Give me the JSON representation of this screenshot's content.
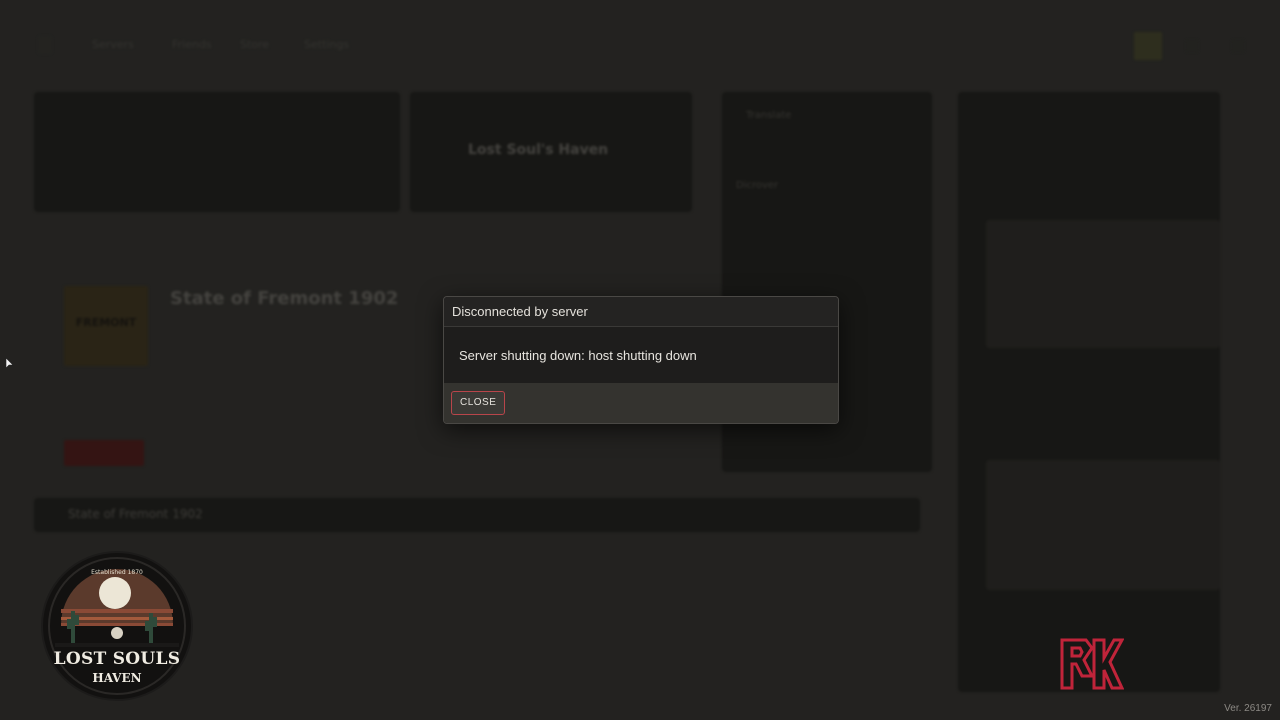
{
  "background": {
    "nav": [
      "Servers",
      "Friends",
      "Store",
      "Settings"
    ],
    "server_header": "Lost Soul's Haven",
    "game_title": "State of Fremont 1902",
    "game_subtitle": "State of Fremont 1902",
    "cover_text": "FREMONT",
    "news_label_1": "Translate",
    "news_label_2": "Dicrover"
  },
  "modal": {
    "title": "Disconnected by server",
    "message": "Server shutting down: host shutting down",
    "close_label": "CLOSE"
  },
  "badge": {
    "established": "Established 1870",
    "name_line1": "LOST SOULS",
    "name_line2": "HAVEN"
  },
  "version": "Ver. 26197",
  "colors": {
    "modal_bg": "#1e1d1c",
    "close_border": "#b8454a",
    "rk_logo": "#c0243a"
  }
}
